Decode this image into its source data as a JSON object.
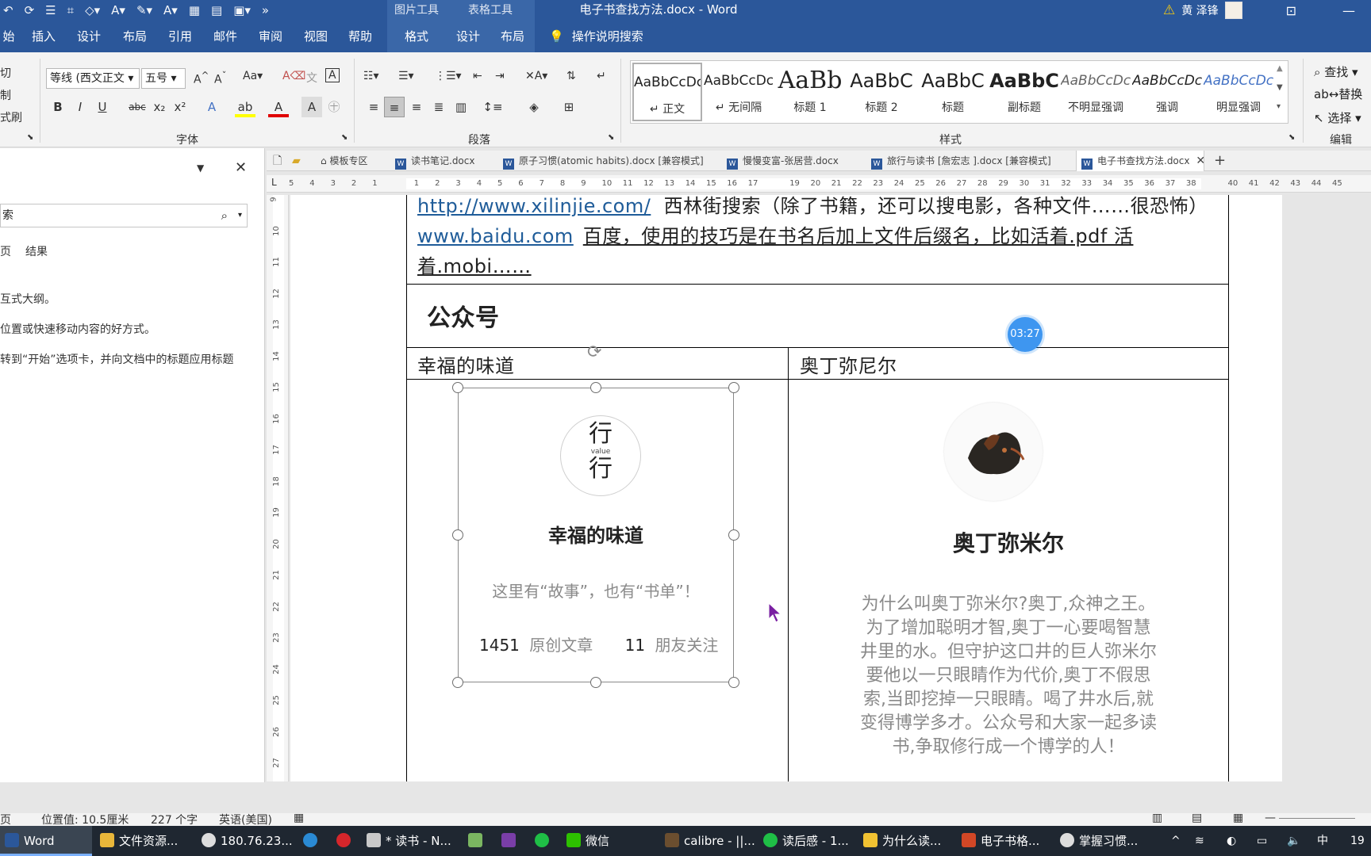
{
  "titlebar": {
    "ctx_picture_tools": "图片工具",
    "ctx_table_tools": "表格工具",
    "doc_title": "电子书查找方法.docx  -  Word",
    "user_name": "黄 泽锋"
  },
  "tabs": [
    "始",
    "插入",
    "设计",
    "布局",
    "引用",
    "邮件",
    "审阅",
    "视图",
    "帮助",
    "格式",
    "设计",
    "布局"
  ],
  "tell_me": "操作说明搜索",
  "clipboard": {
    "cut": "切",
    "copy": "制",
    "format_painter": "式刷"
  },
  "font": {
    "name": "等线 (西文正文",
    "size": "五号",
    "group_label": "字体"
  },
  "paragraph": {
    "group_label": "段落"
  },
  "styles": {
    "group_label": "样式",
    "items": [
      {
        "preview": "AaBbCcDc",
        "name": "↵ 正文"
      },
      {
        "preview": "AaBbCcDc",
        "name": "↵ 无间隔"
      },
      {
        "preview": "AaBb",
        "name": "标题 1"
      },
      {
        "preview": "AaBbC",
        "name": "标题 2"
      },
      {
        "preview": "AaBbC",
        "name": "标题"
      },
      {
        "preview": "AaBbC",
        "name": "副标题"
      },
      {
        "preview": "AaBbCcDc",
        "name": "不明显强调"
      },
      {
        "preview": "AaBbCcDc",
        "name": "强调"
      },
      {
        "preview": "AaBbCcDc",
        "name": "明显强调"
      }
    ]
  },
  "editing": {
    "group_label": "编辑",
    "find": "查找",
    "replace": "替换",
    "select": "选择"
  },
  "nav_pane": {
    "search_placeholder": "索",
    "tab_headings": "页",
    "tab_results": "结果",
    "text1": "互式大纲。",
    "text2": "位置或快速移动内容的好方式。",
    "text3": "转到“开始”选项卡，并向文档中的标题应用标题"
  },
  "doc_tabs": [
    {
      "label": "模板专区"
    },
    {
      "label": "读书笔记.docx"
    },
    {
      "label": "原子习惯(atomic habits).docx [兼容模式]"
    },
    {
      "label": "慢慢变富-张居营.docx"
    },
    {
      "label": "旅行与读书 [詹宏志 ].docx [兼容模式]"
    },
    {
      "label": "电子书查找方法.docx"
    }
  ],
  "ruler_h": [
    "5",
    "4",
    "3",
    "2",
    "1",
    "",
    "1",
    "2",
    "3",
    "4",
    "5",
    "6",
    "7",
    "8",
    "9",
    "10",
    "11",
    "12",
    "13",
    "14",
    "15",
    "16",
    "17",
    "",
    "19",
    "20",
    "21",
    "22",
    "23",
    "24",
    "25",
    "26",
    "27",
    "28",
    "29",
    "30",
    "31",
    "32",
    "33",
    "34",
    "35",
    "36",
    "37",
    "38",
    "",
    "40",
    "41",
    "42",
    "43",
    "44",
    "45"
  ],
  "ruler_v": [
    "9",
    "10",
    "11",
    "12",
    "13",
    "14",
    "15",
    "16",
    "17",
    "18",
    "19",
    "20",
    "21",
    "22",
    "23",
    "24",
    "25",
    "26",
    "27"
  ],
  "document": {
    "line1_link": "http://www.xilinjie.com/",
    "line1_text": "西林街搜索（除了书籍，还可以搜电影，各种文件……很恐怖）",
    "line2_link": "www.baidu.com",
    "line2_text": "百度，使用的技巧是在书名后加上文件后缀名，比如活着.pdf   活",
    "line3_text": "着.mobi……",
    "section_heading": "公众号",
    "col1_header": "幸福的味道",
    "col2_header": "奥丁弥尼尔",
    "card1": {
      "logo_top": "行",
      "logo_mid": "value",
      "logo_bottom": "行",
      "title": "幸福的味道",
      "subtitle": "这里有“故事”，也有“书单”！",
      "articles_count": "1451",
      "articles_label": "原创文章",
      "friends_count": "11",
      "friends_label": "朋友关注"
    },
    "card2": {
      "title": "奥丁弥米尔",
      "desc": [
        "为什么叫奥丁弥米尔?奥丁,众神之王。",
        "为了增加聪明才智,奥丁一心要喝智慧",
        "井里的水。但守护这口井的巨人弥米尔",
        "要他以一只眼睛作为代价,奥丁不假思",
        "索,当即挖掉一只眼睛。喝了井水后,就",
        "变得博学多才。公众号和大家一起多读",
        "书,争取修行成一个博学的人！"
      ]
    }
  },
  "timer": "03:27",
  "status": {
    "page": "页",
    "position": "位置值: 10.5厘米",
    "words": "227 个字",
    "lang": "英语(美国)"
  },
  "taskbar": {
    "items": [
      {
        "label": "Word"
      },
      {
        "label": "文件资源..."
      },
      {
        "label": "180.76.23..."
      },
      {
        "label": ""
      },
      {
        "label": ""
      },
      {
        "label": "* 读书 - N..."
      },
      {
        "label": ""
      },
      {
        "label": ""
      },
      {
        "label": ""
      },
      {
        "label": "微信"
      },
      {
        "label": "calibre - ||..."
      },
      {
        "label": "读后感 - 1..."
      },
      {
        "label": "为什么读..."
      },
      {
        "label": "电子书格..."
      },
      {
        "label": "掌握习惯..."
      }
    ],
    "clock": "19"
  },
  "colors": {
    "word_blue": "#2b579a",
    "link_blue": "#1f5c99",
    "timer_blue": "#3e96f0",
    "taskbar_bg": "#1f2731"
  }
}
